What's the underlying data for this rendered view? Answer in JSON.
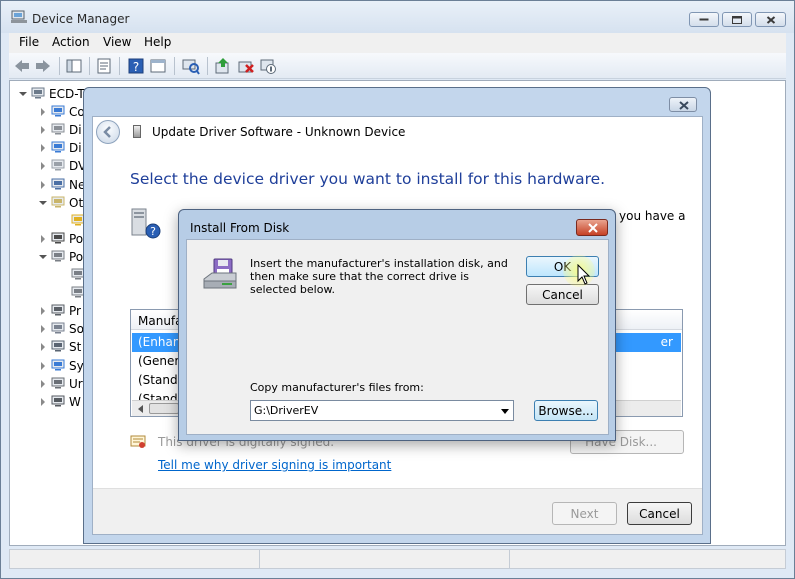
{
  "device_manager": {
    "title": "Device Manager",
    "menu": [
      "File",
      "Action",
      "View",
      "Help"
    ],
    "tree": [
      {
        "label": "ECD-T",
        "icon": "computer-icon",
        "expanded": true
      },
      {
        "label": "Co",
        "icon": "monitor-icon"
      },
      {
        "label": "Di",
        "icon": "disk-drive-icon"
      },
      {
        "label": "Di",
        "icon": "display-adapter-icon"
      },
      {
        "label": "DV",
        "icon": "dvd-drive-icon"
      },
      {
        "label": "Ne",
        "icon": "network-icon"
      },
      {
        "label": "Ot",
        "icon": "other-devices-icon",
        "expanded": true
      },
      {
        "label": "",
        "icon": "unknown-device-icon"
      },
      {
        "label": "Po",
        "icon": "portable-device-icon"
      },
      {
        "label": "Po",
        "icon": "port-icon",
        "expanded": true
      },
      {
        "label": "",
        "icon": "port-child-icon"
      },
      {
        "label": "",
        "icon": "port-child-icon"
      },
      {
        "label": "Pr",
        "icon": "processor-icon"
      },
      {
        "label": "So",
        "icon": "sound-icon"
      },
      {
        "label": "St",
        "icon": "storage-icon"
      },
      {
        "label": "Sy",
        "icon": "system-icon"
      },
      {
        "label": "Ur",
        "icon": "usb-icon"
      },
      {
        "label": "W",
        "icon": "wsd-printer-icon"
      }
    ]
  },
  "update_driver": {
    "title": "Update Driver Software - Unknown Device",
    "heading": "Select the device driver you want to install for this hardware.",
    "partial_text": "you have a",
    "list_header": "Manufa",
    "list_items": [
      "(Enhanc",
      "(Generic",
      "(Standa",
      "(Standa"
    ],
    "list_selected_tail": "er",
    "signed_text": "This driver is digitally signed.",
    "signing_link": "Tell me why driver signing is important",
    "have_disk_label": "Have Disk...",
    "next_label": "Next",
    "cancel_label": "Cancel"
  },
  "install_from_disk": {
    "title": "Install From Disk",
    "message": "Insert the manufacturer's installation disk, and then make sure that the correct drive is selected below.",
    "ok_label": "OK",
    "cancel_label": "Cancel",
    "copy_label": "Copy manufacturer's files from:",
    "path_value": "G:\\DriverEV",
    "browse_label": "Browse..."
  },
  "colors": {
    "heading_blue": "#1f3f9a",
    "link_blue": "#0066cc",
    "selection_blue": "#3399ff",
    "close_red": "#c64125"
  }
}
